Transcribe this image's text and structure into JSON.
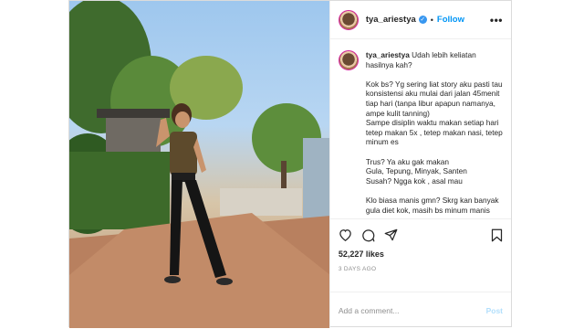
{
  "post": {
    "username": "tya_ariestya",
    "follow_label": "Follow",
    "separator": "•",
    "more_icon": "•••",
    "verified_mark": "✓",
    "caption_text": " Udah lebih keliatan hasilnya kah?\n\nKok bs? Yg sering liat story aku pasti tau konsistensi aku mulai dari jalan 45menit tiap hari (tanpa libur apapun namanya, ampe kulit tanning)\nSampe disiplin waktu makan setiap hari tetep makan 5x , tetep makan nasi, tetep minum es\n\nTrus? Ya aku gak makan\nGula, Tepung, Minyak, Santen\nSusah? Ngga kok , asal mau\n\nKlo biasa manis gmn? Skrg kan banyak gula diet kok, masih bs minum manis\n\nTrus gak bs gak minyak? Gak bs apa",
    "likes": "52,227 likes",
    "time_ago": "3 DAYS AGO",
    "comment_placeholder": "Add a comment...",
    "post_label": "Post"
  },
  "icons": [
    "heart-icon",
    "comment-icon",
    "share-icon",
    "bookmark-icon"
  ],
  "colors": {
    "accent": "#0095f6",
    "verified": "#3897f0",
    "border": "#dbdbdb"
  }
}
